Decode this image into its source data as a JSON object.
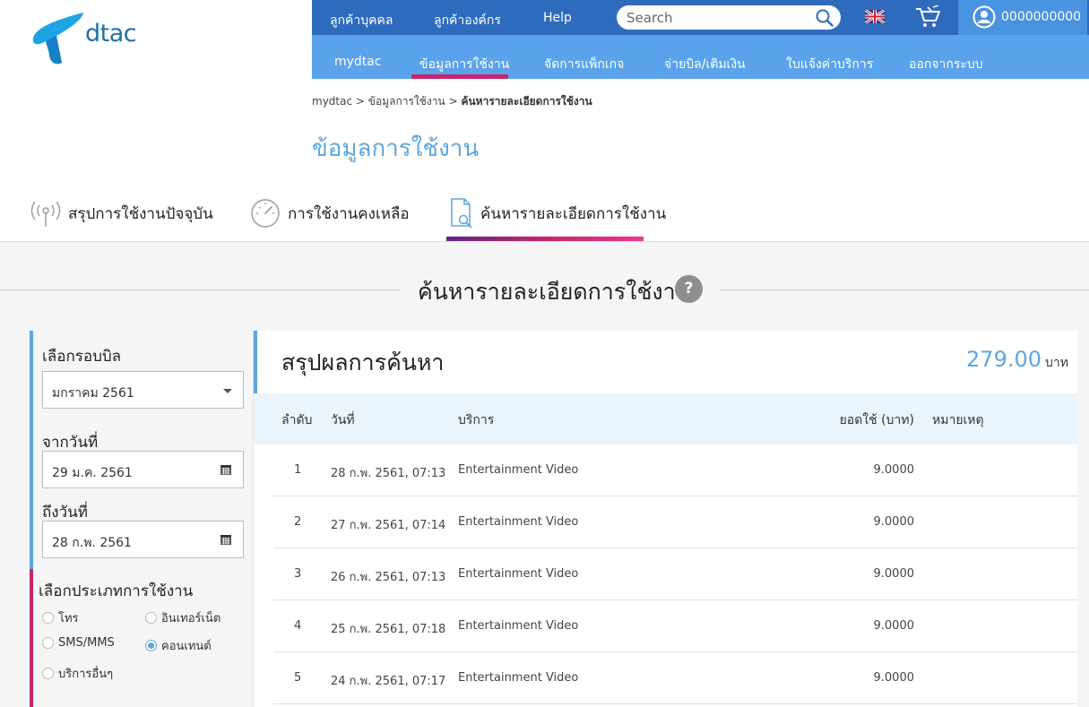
{
  "logo": {
    "text": "dtac"
  },
  "topnav": {
    "personal": "ลูกค้าบุคคล",
    "business": "ลูกค้าองค์กร",
    "help": "Help",
    "search_placeholder": "Search",
    "username": "0000000000"
  },
  "subnav": {
    "items": [
      "mydtac",
      "ข้อมูลการใช้งาน",
      "จัดการแพ็กเกจ",
      "จ่ายบิล/เติมเงิน",
      "ใบแจ้งค่าบริการ",
      "ออกจากระบบ"
    ],
    "active_index": 1
  },
  "breadcrumb": {
    "home": "mydtac",
    "sep": ">",
    "level1": "ข้อมูลการใช้งาน",
    "current": "ค้นหารายละเอียดการใช้งาน"
  },
  "page_title": "ข้อมูลการใช้งาน",
  "tabs": [
    {
      "label": "สรุปการใช้งานปัจจุบัน",
      "icon": "signal-tower-icon"
    },
    {
      "label": "การใช้งานคงเหลือ",
      "icon": "speedometer-icon"
    },
    {
      "label": "ค้นหารายละเอียดการใช้งาน",
      "icon": "document-search-icon",
      "active": true
    }
  ],
  "section_title": "ค้นหารายละเอียดการใช้งาน",
  "help_label": "?",
  "filter": {
    "bill_cycle_label": "เลือกรอบบิล",
    "bill_cycle_value": "มกราคม 2561",
    "from_label": "จากวันที่",
    "from_value": "29 ม.ค. 2561",
    "to_label": "ถึงวันที่",
    "to_value": "28 ก.พ. 2561",
    "type_label": "เลือกประเภทการใช้งาน",
    "types": [
      {
        "label": "โทร",
        "checked": false
      },
      {
        "label": "อินเทอร์เน็ต",
        "checked": false
      },
      {
        "label": "SMS/MMS",
        "checked": false
      },
      {
        "label": "คอนเทนต์",
        "checked": true
      },
      {
        "label": "บริการอื่นๆ",
        "checked": false
      }
    ]
  },
  "results": {
    "title": "สรุปผลการค้นหา",
    "total_amount": "279.00",
    "total_unit": "บาท",
    "headers": {
      "no": "ลำดับ",
      "date": "วันที่",
      "service": "บริการ",
      "amount": "ยอดใช้ (บาท)",
      "note": "หมายเหตุ"
    },
    "rows": [
      {
        "no": "1",
        "date": "28 ก.พ. 2561, 07:13",
        "service": "Entertainment Video",
        "amount": "9.0000",
        "note": ""
      },
      {
        "no": "2",
        "date": "27 ก.พ. 2561, 07:14",
        "service": "Entertainment Video",
        "amount": "9.0000",
        "note": ""
      },
      {
        "no": "3",
        "date": "26 ก.พ. 2561, 07:13",
        "service": "Entertainment Video",
        "amount": "9.0000",
        "note": ""
      },
      {
        "no": "4",
        "date": "25 ก.พ. 2561, 07:18",
        "service": "Entertainment Video",
        "amount": "9.0000",
        "note": ""
      },
      {
        "no": "5",
        "date": "24 ก.พ. 2561, 07:17",
        "service": "Entertainment Video",
        "amount": "9.0000",
        "note": ""
      }
    ]
  },
  "colors": {
    "primary_blue": "#2e6bbd",
    "light_blue": "#5aa3ea",
    "accent_pink": "#c8246b",
    "title_blue": "#5ba6e2"
  }
}
